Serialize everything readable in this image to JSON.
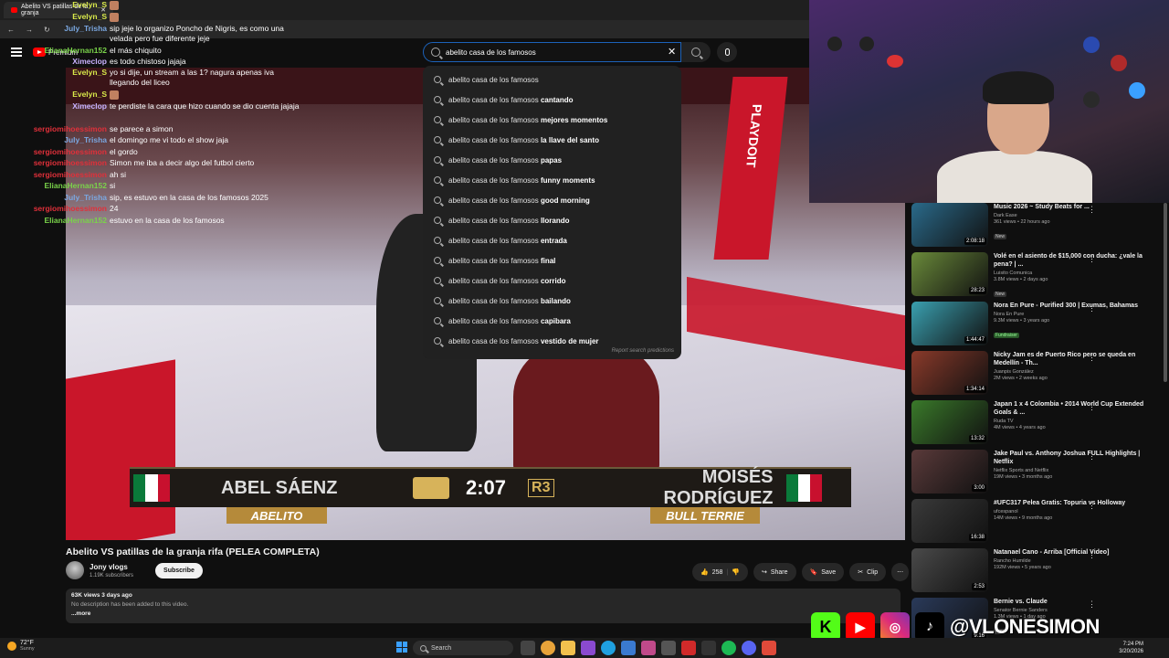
{
  "browser": {
    "tab_title": "Abelito VS patillas de la granja",
    "url": "youtube.com"
  },
  "header": {
    "logo_text": "Premium",
    "search_value": "abelito casa de los famosos",
    "search_placeholder": "Search"
  },
  "suggestions": {
    "prefix": "abelito casa de los famosos",
    "items": [
      {
        "suffix": ""
      },
      {
        "suffix": " cantando"
      },
      {
        "suffix": " mejores momentos"
      },
      {
        "suffix": " la llave del santo"
      },
      {
        "suffix": " papas"
      },
      {
        "suffix": " funny moments"
      },
      {
        "suffix": " good morning"
      },
      {
        "suffix": " llorando"
      },
      {
        "suffix": " entrada"
      },
      {
        "suffix": " final"
      },
      {
        "suffix": " corrido"
      },
      {
        "suffix": " bailando"
      },
      {
        "suffix": " capibara"
      },
      {
        "suffix": " vestido de mujer"
      }
    ],
    "report": "Report search predictions"
  },
  "chat": [
    {
      "user": "Evelyn_S",
      "color": "#d8e84a",
      "msg": ""
    },
    {
      "user": "Evelyn_S",
      "color": "#d8e84a",
      "msg": ""
    },
    {
      "user": "July_Trisha",
      "color": "#7aa7e0",
      "msg": "sip jeje lo organizo Poncho de Nigris, es como una velada pero fue diferente jeje"
    },
    {
      "user": "ElianaHernan152",
      "color": "#7ad34a",
      "msg": "el más chiquito"
    },
    {
      "user": "Ximeclop",
      "color": "#c9b1ff",
      "msg": "es todo chistoso jajaja"
    },
    {
      "user": "Evelyn_S",
      "color": "#d8e84a",
      "msg": "yo si dije, un stream a las 1? nagura apenas iva llegando del liceo"
    },
    {
      "user": "Evelyn_S",
      "color": "#d8e84a",
      "msg": ""
    },
    {
      "user": "Ximeclop",
      "color": "#c9b1ff",
      "msg": "te perdiste la cara que hizo cuando se dio cuenta jajaja"
    },
    {
      "user": "sergiomihoessimon",
      "color": "#e0303a",
      "msg": "se parece a simon"
    },
    {
      "user": "July_Trisha",
      "color": "#7aa7e0",
      "msg": "el domingo me vi todo el show jaja"
    },
    {
      "user": "sergiomihoessimon",
      "color": "#e0303a",
      "msg": "el gordo"
    },
    {
      "user": "sergiomihoessimon",
      "color": "#e0303a",
      "msg": "Simon me iba a decir algo del futbol cierto"
    },
    {
      "user": "sergiomihoessimon",
      "color": "#e0303a",
      "msg": "ah si"
    },
    {
      "user": "ElianaHernan152",
      "color": "#7ad34a",
      "msg": "si"
    },
    {
      "user": "July_Trisha",
      "color": "#7aa7e0",
      "msg": "sip, es estuvo en la casa de los famosos 2025"
    },
    {
      "user": "sergiomihoessimon",
      "color": "#e0303a",
      "msg": "24"
    },
    {
      "user": "ElianaHernan152",
      "color": "#7ad34a",
      "msg": "estuvo en la casa de los famosos"
    }
  ],
  "video": {
    "fighter_left": "ABEL SÁENZ",
    "fighter_left_nick": "ABELITO",
    "fighter_right": "MOISÉS RODRÍGUEZ",
    "fighter_right_nick": "BULL TERRIE",
    "timer": "2:07",
    "round": "R3",
    "ring_sponsor": "PLAYDOIT"
  },
  "details": {
    "title": "Abelito VS patillas de la granja rifa (PELEA COMPLETA)",
    "channel": "Jony vlogs",
    "subscribers": "1.19K subscribers",
    "subscribe_label": "Subscribe",
    "likes": "258",
    "share_label": "Share",
    "save_label": "Save",
    "clip_label": "Clip",
    "more_actions": "⋯",
    "views_date": "63K views  3 days ago",
    "description": "No description has been added to this video.",
    "more_label": "...more"
  },
  "recommended": [
    {
      "title": "Music 2026 ~ Study Beats for ...",
      "channel": "Dark Ease",
      "meta": "361 views • 22 hours ago",
      "badge": "New",
      "duration": "2:08:18",
      "color": "#2a6a8a"
    },
    {
      "title": "Volé en el asiento de $15,000 con ducha: ¿vale la pena? | ...",
      "channel": "Luisito Comunica",
      "meta": "3.8M views • 2 days ago",
      "badge": "New",
      "duration": "28:23",
      "color": "#6a8a3a"
    },
    {
      "title": "Nora En Pure - Purified 300 | Exumas, Bahamas",
      "channel": "Nora En Pure",
      "meta": "9.3M views • 3 years ago",
      "badge": "Fundraiser",
      "duration": "1:44:47",
      "color": "#3aa0b0"
    },
    {
      "title": "Nicky Jam es de Puerto Rico pero se queda en Medellín - Th...",
      "channel": "Juanpis González",
      "meta": "2M views • 2 weeks ago",
      "badge": "",
      "duration": "1:34:14",
      "color": "#8a3a2a"
    },
    {
      "title": "Japan 1 x 4 Colombia • 2014 World Cup Extended Goals & ...",
      "channel": "Ruda TV",
      "meta": "4M views • 4 years ago",
      "badge": "",
      "duration": "13:32",
      "color": "#3a7a2a"
    },
    {
      "title": "Jake Paul vs. Anthony Joshua FULL Highlights | Netflix",
      "channel": "Netflix Sports and Netflix",
      "meta": "19M views • 3 months ago",
      "badge": "",
      "duration": "3:00",
      "color": "#5a3a3a"
    },
    {
      "title": "#UFC317 Pelea Gratis: Topuria vs Holloway",
      "channel": "ufcespanol",
      "meta": "14M views • 9 months ago",
      "badge": "",
      "duration": "16:38",
      "color": "#3a3a3a"
    },
    {
      "title": "Natanael Cano - Arriba [Official Video]",
      "channel": "Rancho Humilde",
      "meta": "192M views • 5 years ago",
      "badge": "",
      "duration": "2:53",
      "color": "#4a4a4a"
    },
    {
      "title": "Bernie vs. Claude",
      "channel": "Senator Bernie Sanders",
      "meta": "1.3M views • 1 day ago",
      "badge": "New",
      "duration": "9:16",
      "color": "#2a3a5a"
    }
  ],
  "social": {
    "handle": "@VLONESIMON",
    "icons": [
      "kick-icon",
      "youtube-icon",
      "instagram-icon",
      "tiktok-icon"
    ]
  },
  "taskbar": {
    "temp": "72°F",
    "weather": "Sunny",
    "search_label": "Search",
    "time": "7:24 PM",
    "date": "3/20/2026"
  }
}
